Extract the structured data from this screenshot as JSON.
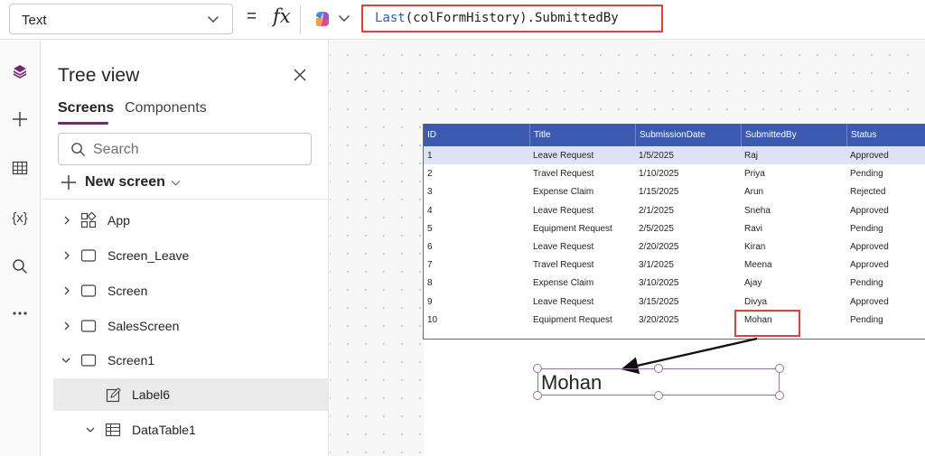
{
  "formula_bar": {
    "property": "Text",
    "equals": "=",
    "fx": "fx",
    "formula_fn": "Last",
    "formula_rest": "(colFormHistory).SubmittedBy"
  },
  "rail": {
    "icons": [
      "layers-icon",
      "plus-icon",
      "table-icon",
      "variables-icon",
      "search-icon",
      "more-icon"
    ],
    "variables_glyph": "{x}"
  },
  "tree": {
    "title": "Tree view",
    "tabs": [
      "Screens",
      "Components"
    ],
    "search_placeholder": "Search",
    "new_screen": "New screen",
    "nodes": [
      {
        "label": "App"
      },
      {
        "label": "Screen_Leave"
      },
      {
        "label": "Screen"
      },
      {
        "label": "SalesScreen"
      },
      {
        "label": "Screen1"
      },
      {
        "label": "Label6"
      },
      {
        "label": "DataTable1"
      }
    ]
  },
  "table": {
    "columns": [
      "ID",
      "Title",
      "SubmissionDate",
      "SubmittedBy",
      "Status"
    ],
    "rows": [
      [
        "1",
        "Leave Request",
        "1/5/2025",
        "Raj",
        "Approved"
      ],
      [
        "2",
        "Travel Request",
        "1/10/2025",
        "Priya",
        "Pending"
      ],
      [
        "3",
        "Expense Claim",
        "1/15/2025",
        "Arun",
        "Rejected"
      ],
      [
        "4",
        "Leave Request",
        "2/1/2025",
        "Sneha",
        "Approved"
      ],
      [
        "5",
        "Equipment Request",
        "2/5/2025",
        "Ravi",
        "Pending"
      ],
      [
        "6",
        "Leave Request",
        "2/20/2025",
        "Kiran",
        "Approved"
      ],
      [
        "7",
        "Travel Request",
        "3/1/2025",
        "Meena",
        "Approved"
      ],
      [
        "8",
        "Expense Claim",
        "3/10/2025",
        "Ajay",
        "Pending"
      ],
      [
        "9",
        "Leave Request",
        "3/15/2025",
        "Divya",
        "Approved"
      ],
      [
        "10",
        "Equipment Request",
        "3/20/2025",
        "Mohan",
        "Pending"
      ]
    ]
  },
  "label6": {
    "text": "Mohan"
  },
  "colors": {
    "accent": "#742774",
    "table_header": "#3b5ab0",
    "highlight_box": "#e43d3d"
  }
}
